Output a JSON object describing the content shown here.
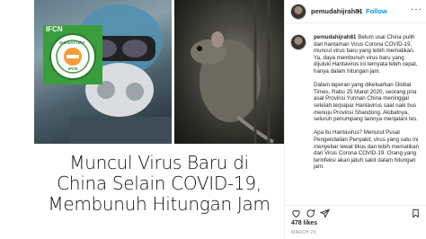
{
  "post": {
    "headline_lines": [
      "Muncul Virus Baru di",
      "China Selain COVID-19,",
      "Membunuh Hitungan Jam"
    ],
    "seal_text_top": "SIGNATORY",
    "seal_text_bottom": "IFCN",
    "seal_brand": "IFCN"
  },
  "panel": {
    "username": "pemudahijrah81",
    "dot": "•",
    "follow_label": "Follow",
    "more_icon": "···",
    "comment_username": "pemudahijrah81",
    "comment_paragraphs": [
      "Belum usai China pulih dari hantaman Virus Corona COVID-19, muncul virus baru yang lebih mematikan. Ya, daya membunuh virus baru yang dijuluki Hantavirus ini ternyata lebih cepat, hanya dalam hitungan jam.",
      "Dalam laporan yang dikeluarkan Global Times, Rabu 25 Maret 2020, seorang pria asal Provinsi Yunnan China meninggal setelah terpapar Hantavirus saat naik bus menuju Provinsi Shandong. Akibatnya, seluruh penumpang lainnya menjalani tes.",
      "Apa itu Hantavirus? Menurut Pusat Pengendalian Penyakit, virus yang satu ini menyebar lewat tikus dan lebih mematikan dari Virus Corona COVID-19. Orang yang terinfeksi akan jatuh sakit dalam hitungan jam."
    ],
    "likes": "478 likes",
    "date": "MARCH 25",
    "icons": [
      "heart-icon",
      "comment-icon",
      "share-icon",
      "bookmark-icon"
    ],
    "colors": {
      "link": "#0095f6",
      "text": "#262626",
      "muted": "#8e8e8e",
      "seal_green": "#3a9d3e"
    }
  }
}
